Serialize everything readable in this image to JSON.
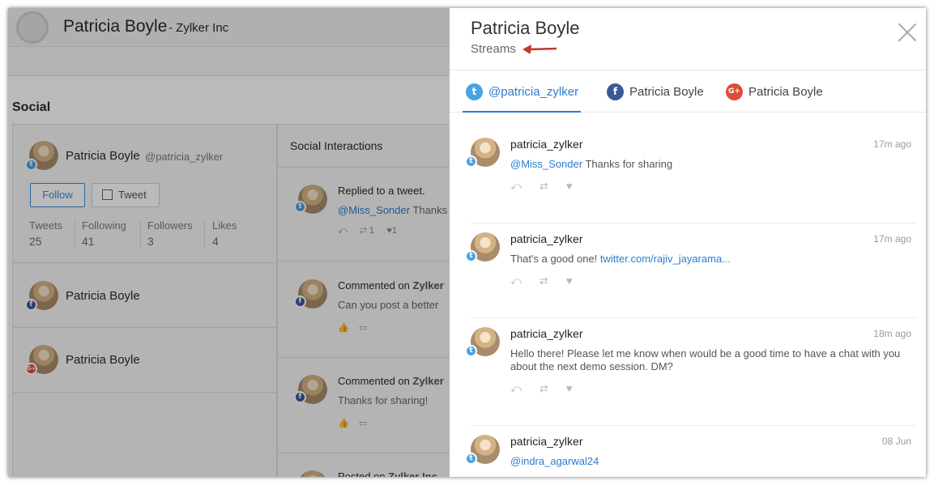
{
  "background": {
    "contact_name": "Patricia Boyle",
    "company": "- Zylker Inc",
    "section_title": "Social",
    "twitter_card": {
      "name": "Patricia Boyle",
      "handle": "@patricia_zylker",
      "follow_label": "Follow",
      "tweet_label": "Tweet",
      "stats": [
        {
          "label": "Tweets",
          "value": "25"
        },
        {
          "label": "Following",
          "value": "41"
        },
        {
          "label": "Followers",
          "value": "3"
        },
        {
          "label": "Likes",
          "value": "4"
        }
      ]
    },
    "facebook_card": {
      "name": "Patricia Boyle"
    },
    "google_card": {
      "name": "Patricia Boyle"
    },
    "interactions": {
      "title": "Social Interactions",
      "items": [
        {
          "title": "Replied to a tweet.",
          "mention": "@Miss_Sonder",
          "body_rest": " Thanks",
          "retweets": "1",
          "likes": "1"
        },
        {
          "title_prefix": "Commented on ",
          "title_bold": "Zylker",
          "body": "Can you post a better"
        },
        {
          "title_prefix": "Commented on ",
          "title_bold": "Zylker",
          "body": "Thanks for sharing!"
        },
        {
          "title_prefix": "Posted on ",
          "title_bold": "Zylker Inc"
        }
      ]
    }
  },
  "panel": {
    "title": "Patricia Boyle",
    "subtitle": "Streams",
    "accent_color": "#2b7cd0",
    "arrow_color": "#c0392b",
    "tabs": [
      {
        "label": "@patricia_zylker",
        "icon": "twitter-icon",
        "active": true
      },
      {
        "label": "Patricia Boyle",
        "icon": "facebook-icon",
        "active": false
      },
      {
        "label": "Patricia Boyle",
        "icon": "google-plus-icon",
        "active": false
      }
    ],
    "posts": [
      {
        "user": "patricia_zylker",
        "time": "17m ago",
        "mention": "@Miss_Sonder",
        "text": " Thanks for sharing"
      },
      {
        "user": "patricia_zylker",
        "time": "17m ago",
        "text": "That's a good one! ",
        "link": "twitter.com/rajiv_jayarama..."
      },
      {
        "user": "patricia_zylker",
        "time": "18m ago",
        "text": "Hello there! Please let me know when would be a good time to have a chat with you about the next demo session. DM?"
      },
      {
        "user": "patricia_zylker",
        "time": "08 Jun",
        "mention": "@indra_agarwal24",
        "text": ""
      }
    ]
  }
}
